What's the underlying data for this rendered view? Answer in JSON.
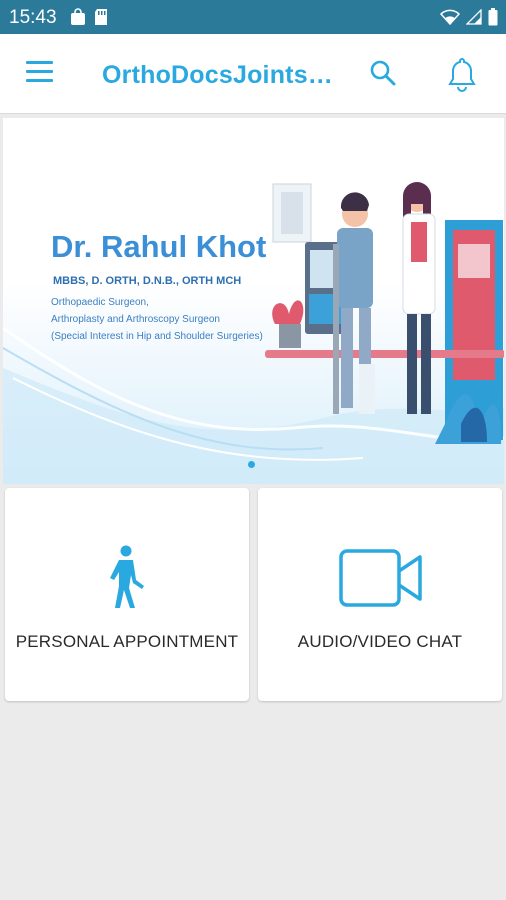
{
  "status_bar": {
    "time": "15:43"
  },
  "app_bar": {
    "title": "OrthoDocsJoints…",
    "menu_icon": "hamburger-icon",
    "search_icon": "search-icon",
    "bell_icon": "bell-icon"
  },
  "banner": {
    "name": "Dr. Rahul Khot",
    "degrees": "MBBS, D. ORTH, D.N.B., ORTH MCH",
    "line1": "Orthopaedic Surgeon,",
    "line2": "Arthroplasty and Arthroscopy Surgeon",
    "line3": "(Special Interest in Hip and Shoulder Surgeries)"
  },
  "cards": {
    "personal": {
      "label": "PERSONAL APPOINTMENT",
      "icon": "walking-person-icon"
    },
    "chat": {
      "label": "AUDIO/VIDEO CHAT",
      "icon": "video-camera-icon"
    }
  },
  "colors": {
    "accent": "#29a9e0",
    "status_bar": "#2b7a99"
  }
}
